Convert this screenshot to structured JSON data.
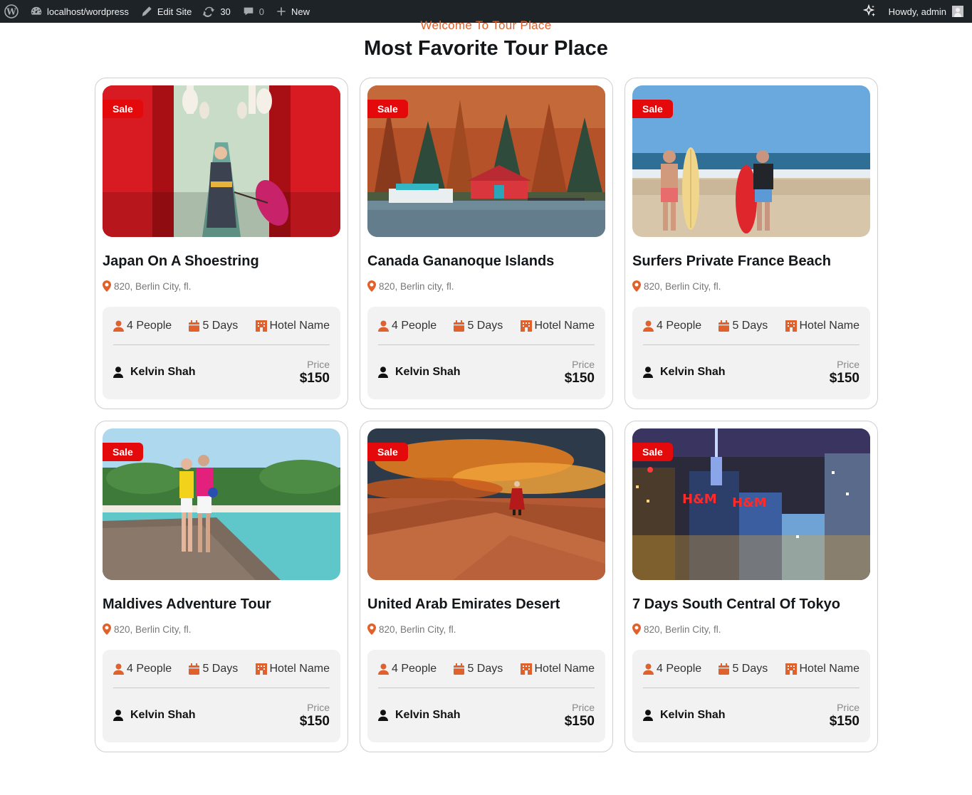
{
  "adminbar": {
    "site": "localhost/wordpress",
    "edit_site": "Edit Site",
    "updates": "30",
    "comments": "0",
    "new": "New",
    "howdy": "Howdy, admin"
  },
  "header": {
    "subtitle": "Welcome To Tour Place",
    "title": "Most Favorite Tour Place"
  },
  "colors": {
    "accent": "#e0612b",
    "sale": "#e4090a",
    "adminbar": "#1d2327"
  },
  "cards": [
    {
      "sale": "Sale",
      "title": "Japan On A Shoestring",
      "location": "820, Berlin City, fl.",
      "people": "4 People",
      "days": "5 Days",
      "hotel": "Hotel Name",
      "agent": "Kelvin Shah",
      "price_label": "Price",
      "price": "$150"
    },
    {
      "sale": "Sale",
      "title": "Canada Gananoque Islands",
      "location": "820, Berlin city, fl.",
      "people": "4 People",
      "days": "5 Days",
      "hotel": "Hotel Name",
      "agent": "Kelvin Shah",
      "price_label": "Price",
      "price": "$150"
    },
    {
      "sale": "Sale",
      "title": "Surfers Private France Beach",
      "location": "820, Berlin City, fl.",
      "people": "4 People",
      "days": "5 Days",
      "hotel": "Hotel Name",
      "agent": "Kelvin Shah",
      "price_label": "Price",
      "price": "$150"
    },
    {
      "sale": "Sale",
      "title": "Maldives Adventure Tour",
      "location": "820, Berlin City, fl.",
      "people": "4 People",
      "days": "5 Days",
      "hotel": "Hotel Name",
      "agent": "Kelvin Shah",
      "price_label": "Price",
      "price": "$150"
    },
    {
      "sale": "Sale",
      "title": "United Arab Emirates Desert",
      "location": "820, Berlin City, fl.",
      "people": "4 People",
      "days": "5 Days",
      "hotel": "Hotel Name",
      "agent": "Kelvin Shah",
      "price_label": "Price",
      "price": "$150"
    },
    {
      "sale": "Sale",
      "title": "7 Days South Central Of Tokyo",
      "location": "820, Berlin City, fl.",
      "people": "4 People",
      "days": "5 Days",
      "hotel": "Hotel Name",
      "agent": "Kelvin Shah",
      "price_label": "Price",
      "price": "$150"
    }
  ]
}
